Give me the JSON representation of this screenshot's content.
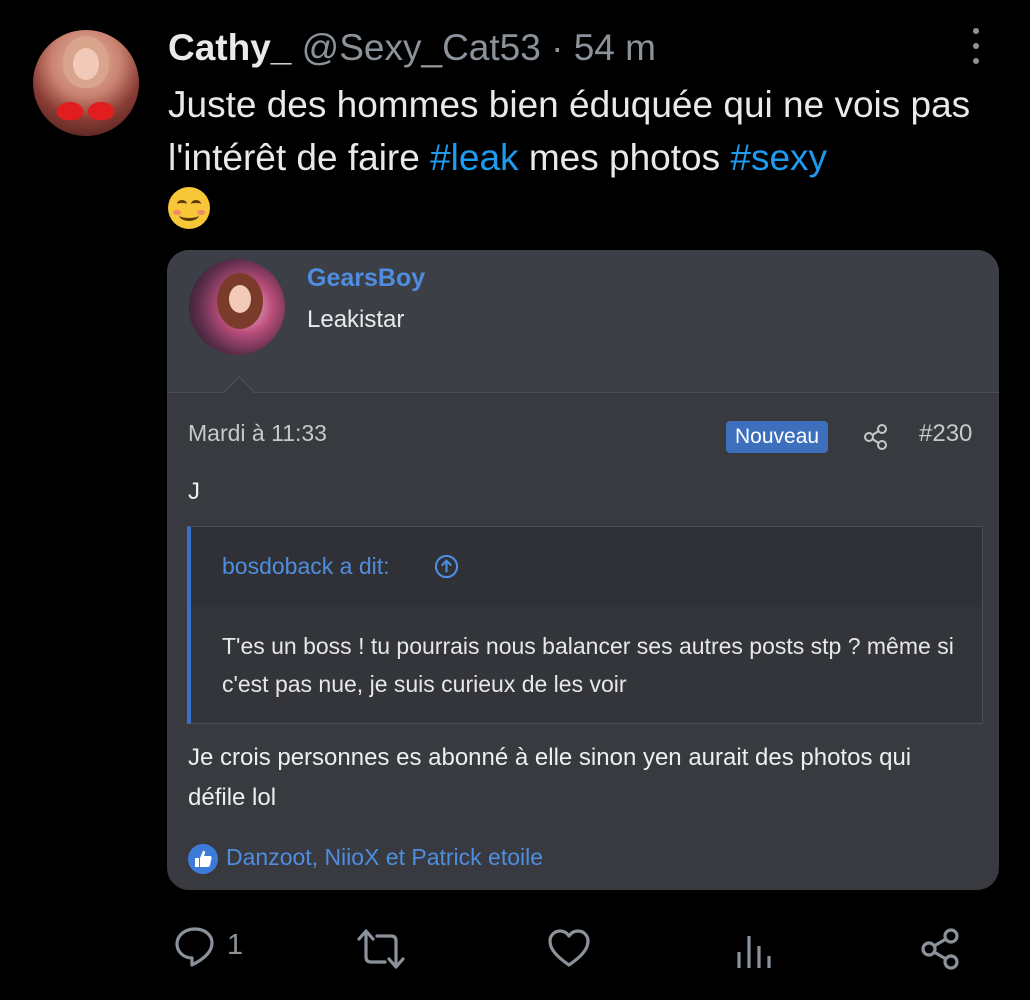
{
  "tweet": {
    "author_name": "Cathy_",
    "handle": "@Sexy_Cat53",
    "separator": "·",
    "time": "54 m",
    "text_part1": "Juste des hommes bien éduquée qui ne vois pas l'intérêt de faire ",
    "hashtag1": "#leak",
    "text_part2": " mes photos ",
    "hashtag2": "#sexy",
    "emoji_icon": "smiling-face-with-blush-icon"
  },
  "embedded_post": {
    "username": "GearsBoy",
    "user_title": "Leakistar",
    "date": "Mardi à 11:33",
    "badge": "Nouveau",
    "post_number": "#230",
    "first_line": "J",
    "quote": {
      "author": "bosdoback a dit:",
      "text": "T'es un boss ! tu pourrais nous balancer ses autres posts stp ? même si c'est pas nue, je suis curieux de les voir"
    },
    "reply": "Je crois personnes es abonné à elle sinon yen aurait des photos qui défile lol",
    "likes": "Danzoot, NiioX et Patrick etoile"
  },
  "actions": {
    "reply_count": "1",
    "icons": [
      "reply-icon",
      "retweet-icon",
      "like-icon",
      "views-icon",
      "share-icon"
    ]
  },
  "colors": {
    "background": "#000000",
    "text": "#e7e9ea",
    "muted": "#8b9299",
    "hashtag": "#1d9bf0",
    "card": "#383a40",
    "forum_link": "#4f8de0",
    "badge": "#3d6fbd"
  }
}
